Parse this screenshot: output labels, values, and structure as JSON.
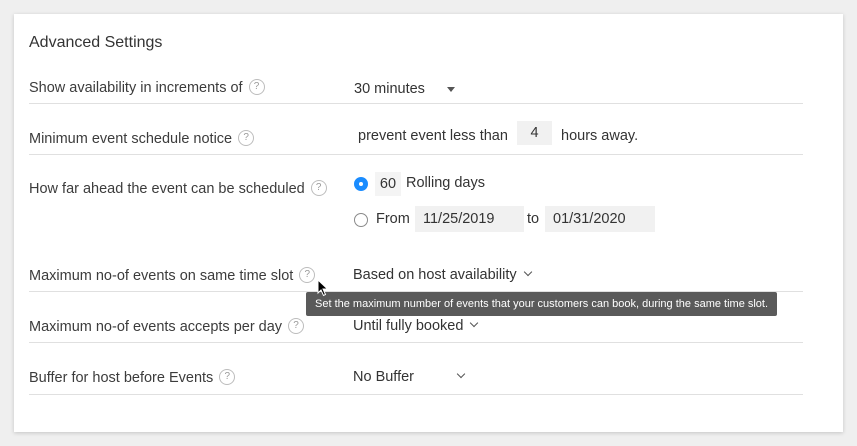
{
  "section_title": "Advanced Settings",
  "help_glyph": "?",
  "rows": {
    "increments": {
      "label": "Show availability in increments of",
      "value": "30 minutes"
    },
    "notice": {
      "label": "Minimum event schedule notice",
      "prefix": "prevent event less than",
      "hours": "4",
      "suffix": "hours away."
    },
    "ahead": {
      "label": "How far ahead the event can be scheduled",
      "rolling_days": "60",
      "rolling_label": "Rolling days",
      "from_label": "From",
      "from_date": "11/25/2019",
      "to_label": "to",
      "to_date": "01/31/2020",
      "selected": "rolling"
    },
    "same_slot": {
      "label": "Maximum no-of events on same time slot",
      "value": "Based on host availability"
    },
    "per_day": {
      "label": "Maximum no-of events accepts per day",
      "value": "Until fully booked"
    },
    "buffer": {
      "label": "Buffer for host before Events",
      "value": "No Buffer"
    }
  },
  "tooltip": "Set the maximum number of events that your customers can book, during the same time slot.",
  "colors": {
    "accent": "#1a8cff",
    "tooltip_bg": "#5a5a5a"
  }
}
